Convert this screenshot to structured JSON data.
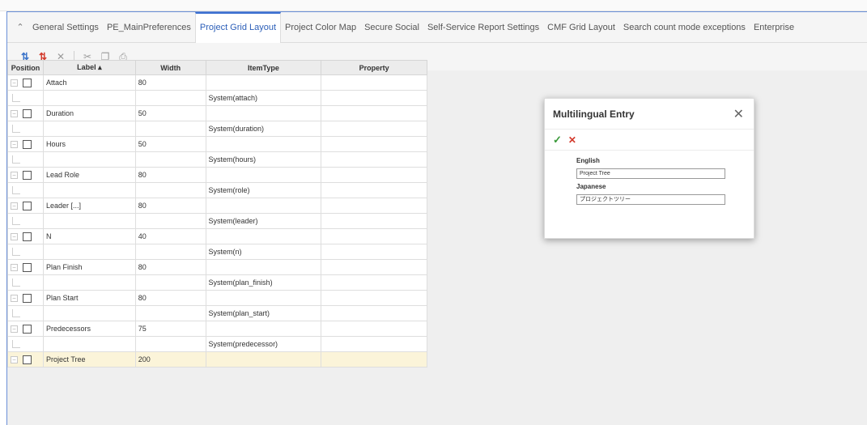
{
  "tabs": [
    {
      "label": "General Settings",
      "active": false
    },
    {
      "label": "PE_MainPreferences",
      "active": false
    },
    {
      "label": "Project Grid Layout",
      "active": true
    },
    {
      "label": "Project Color Map",
      "active": false
    },
    {
      "label": "Secure Social",
      "active": false
    },
    {
      "label": "Self-Service Report Settings",
      "active": false
    },
    {
      "label": "CMF Grid Layout",
      "active": false
    },
    {
      "label": "Search count mode exceptions",
      "active": false
    },
    {
      "label": "Enterprise",
      "active": false
    }
  ],
  "toolbar_icons": [
    "sort-ascending-icon",
    "sort-descending-icon",
    "delete-icon",
    "cut-icon",
    "copy-icon",
    "paste-icon"
  ],
  "grid": {
    "headers": {
      "position": "Position",
      "label": "Label ▴",
      "width": "Width",
      "item_type": "ItemType",
      "property": "Property"
    },
    "rows": [
      {
        "kind": "parent",
        "label": "Attach",
        "width": "80"
      },
      {
        "kind": "child",
        "item_type": "System(attach)"
      },
      {
        "kind": "parent",
        "label": "Duration",
        "width": "50"
      },
      {
        "kind": "child",
        "item_type": "System(duration)"
      },
      {
        "kind": "parent",
        "label": "Hours",
        "width": "50"
      },
      {
        "kind": "child",
        "item_type": "System(hours)"
      },
      {
        "kind": "parent",
        "label": "Lead Role",
        "width": "80"
      },
      {
        "kind": "child",
        "item_type": "System(role)"
      },
      {
        "kind": "parent",
        "label": "Leader [...]",
        "width": "80"
      },
      {
        "kind": "child",
        "item_type": "System(leader)"
      },
      {
        "kind": "parent",
        "label": "N",
        "width": "40"
      },
      {
        "kind": "child",
        "item_type": "System(n)"
      },
      {
        "kind": "parent",
        "label": "Plan Finish",
        "width": "80"
      },
      {
        "kind": "child",
        "item_type": "System(plan_finish)"
      },
      {
        "kind": "parent",
        "label": "Plan Start",
        "width": "80"
      },
      {
        "kind": "child",
        "item_type": "System(plan_start)"
      },
      {
        "kind": "parent",
        "label": "Predecessors",
        "width": "75"
      },
      {
        "kind": "child",
        "item_type": "System(predecessor)"
      },
      {
        "kind": "parent",
        "label": "Project Tree",
        "width": "200",
        "highlight": true
      }
    ]
  },
  "dialog": {
    "title": "Multilingual Entry",
    "fields": [
      {
        "label": "English",
        "value": "Project Tree"
      },
      {
        "label": "Japanese",
        "value": "プロジェクトツリー"
      }
    ]
  },
  "colors": {
    "accent": "#3b6fd0",
    "ok": "#3a9a3a",
    "cancel": "#d33a2c",
    "highlight_row": "#fbf4d9"
  }
}
